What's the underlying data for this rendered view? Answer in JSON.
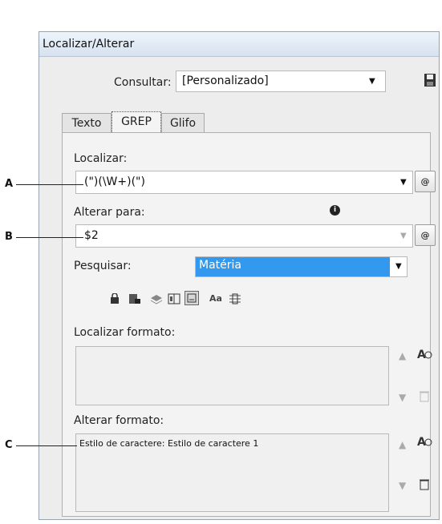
{
  "window": {
    "title": "Localizar/Alterar"
  },
  "query": {
    "label": "Consultar:",
    "value": "[Personalizado]"
  },
  "tabs": [
    {
      "label": "Texto"
    },
    {
      "label": "GREP"
    },
    {
      "label": "Glifo"
    }
  ],
  "find": {
    "label": "Localizar:",
    "value": "(\")(\\W+)(\")"
  },
  "change": {
    "label": "Alterar para:",
    "value": "$2"
  },
  "search": {
    "label": "Pesquisar:",
    "value": "Matéria"
  },
  "options": {
    "case_label": "Aa"
  },
  "find_format": {
    "label": "Localizar formato:",
    "value": ""
  },
  "change_format": {
    "label": "Alterar formato:",
    "value": "Estilo de caractere: Estilo de caractere 1"
  },
  "callouts": {
    "a": "A",
    "b": "B",
    "c": "C"
  },
  "icons": [
    "save-icon",
    "at-special-chars-icon",
    "info-icon",
    "include-locked-layers-icon",
    "include-locked-stories-icon",
    "include-hidden-layers-icon",
    "include-master-pages-icon",
    "include-footnotes-icon",
    "case-sensitive-icon",
    "whole-word-icon",
    "specify-format-icon",
    "clear-format-icon"
  ]
}
